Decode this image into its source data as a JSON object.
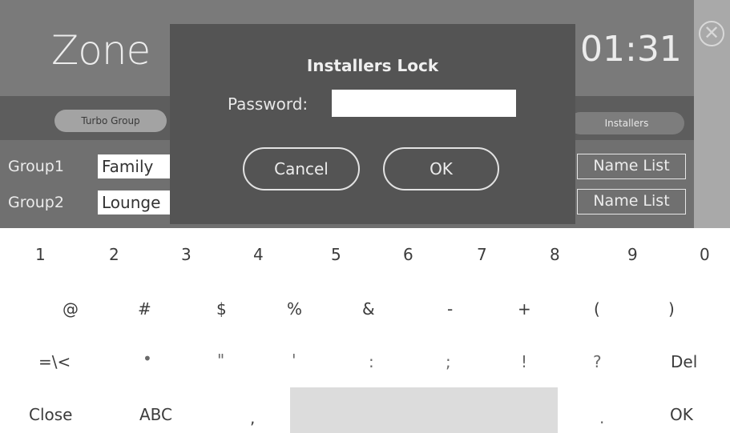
{
  "app": {
    "title": "Zone",
    "clock": "01:31"
  },
  "tabs": {
    "turbo_group": "Turbo Group",
    "installers": "Installers"
  },
  "groups": [
    {
      "label": "Group1",
      "value": "Family",
      "button": "Name List"
    },
    {
      "label": "Group2",
      "value": "Lounge",
      "button": "Name List"
    }
  ],
  "dialog": {
    "title": "Installers Lock",
    "password_label": "Password:",
    "password_value": "",
    "cancel": "Cancel",
    "ok": "OK"
  },
  "keyboard": {
    "row1": [
      "1",
      "2",
      "3",
      "4",
      "5",
      "6",
      "7",
      "8",
      "9",
      "0"
    ],
    "row2": [
      "@",
      "#",
      "$",
      "%",
      "&",
      "-",
      "+",
      "(",
      ")"
    ],
    "row3": [
      "=\\<",
      "•",
      "\"",
      "'",
      ":",
      ";",
      "!",
      "?",
      "Del"
    ],
    "row4": {
      "close": "Close",
      "abc": "ABC",
      "comma": ",",
      "period": ".",
      "ok": "OK"
    }
  },
  "colors": {
    "dialog_bg": "#545454",
    "screen_bg": "#707070",
    "space_bar": "#dcdcdc"
  },
  "icons": {
    "close": "close-circle-icon"
  }
}
